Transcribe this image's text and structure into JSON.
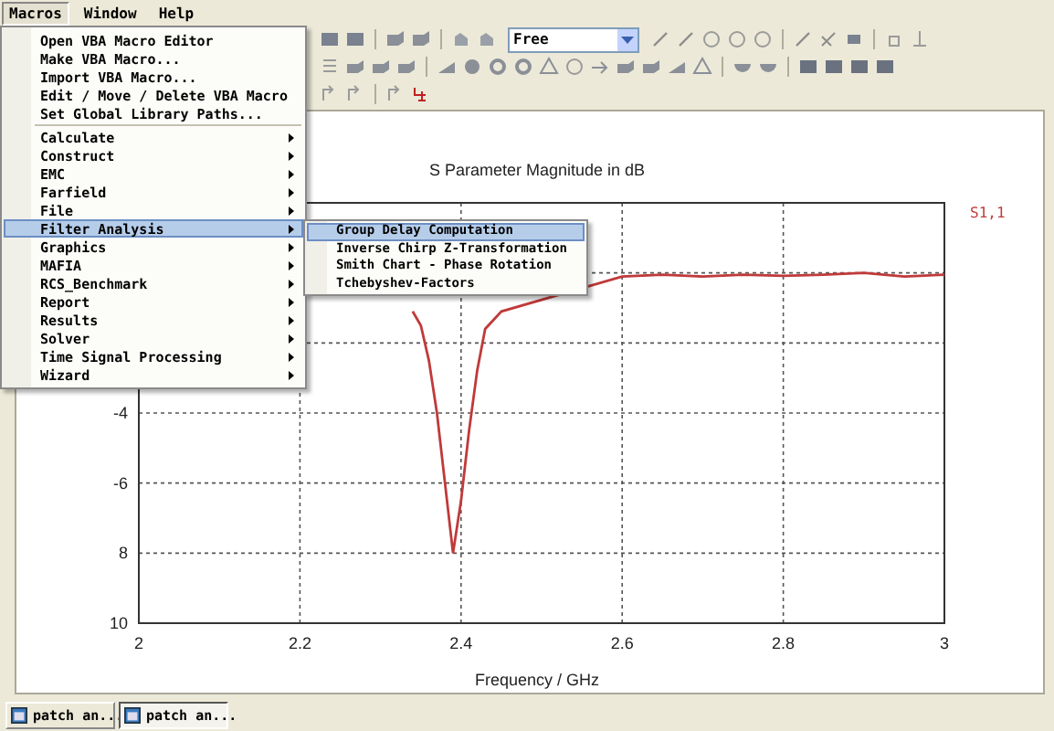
{
  "menubar": [
    {
      "label": "Macros",
      "selected": true
    },
    {
      "label": "Window",
      "selected": false
    },
    {
      "label": "Help",
      "selected": false
    }
  ],
  "toolbar": {
    "dropdown": "Free"
  },
  "macros_menu": [
    {
      "kind": "item",
      "label": "Open VBA Macro Editor",
      "selected": false
    },
    {
      "kind": "item",
      "label": "Make VBA Macro...",
      "selected": false
    },
    {
      "kind": "item",
      "label": "Import VBA Macro...",
      "selected": false
    },
    {
      "kind": "item",
      "label": "Edit / Move / Delete VBA Macro",
      "selected": false
    },
    {
      "kind": "item",
      "label": "Set Global Library Paths...",
      "selected": false
    },
    {
      "kind": "separator"
    },
    {
      "kind": "submenu",
      "label": "Calculate",
      "selected": false
    },
    {
      "kind": "submenu",
      "label": "Construct",
      "selected": false
    },
    {
      "kind": "submenu",
      "label": "EMC",
      "selected": false
    },
    {
      "kind": "submenu",
      "label": "Farfield",
      "selected": false
    },
    {
      "kind": "submenu",
      "label": "File",
      "selected": false
    },
    {
      "kind": "submenu",
      "label": "Filter Analysis",
      "selected": true
    },
    {
      "kind": "submenu",
      "label": "Graphics",
      "selected": false
    },
    {
      "kind": "submenu",
      "label": "MAFIA",
      "selected": false
    },
    {
      "kind": "submenu",
      "label": "RCS_Benchmark",
      "selected": false
    },
    {
      "kind": "submenu",
      "label": "Report",
      "selected": false
    },
    {
      "kind": "submenu",
      "label": "Results",
      "selected": false
    },
    {
      "kind": "submenu",
      "label": "Solver",
      "selected": false
    },
    {
      "kind": "submenu",
      "label": "Time Signal Processing",
      "selected": false
    },
    {
      "kind": "submenu",
      "label": "Wizard",
      "selected": false
    }
  ],
  "filter_submenu": [
    {
      "label": "Group Delay Computation",
      "selected": true
    },
    {
      "label": "Inverse Chirp Z-Transformation",
      "selected": false
    },
    {
      "label": "Smith Chart - Phase Rotation",
      "selected": false
    },
    {
      "label": "Tchebyshev-Factors",
      "selected": false
    }
  ],
  "chart": {
    "chart_data": {
      "type": "line",
      "grid": true,
      "title": "S Parameter Magnitude in dB",
      "xlabel": "Frequency / GHz",
      "xlim": [
        2,
        3
      ],
      "ylim": [
        -10,
        2
      ],
      "xticks": [
        2,
        2.2,
        2.4,
        2.6,
        2.8,
        3
      ],
      "yticks": [
        {
          "value": -4,
          "label": "-4"
        },
        {
          "value": -6,
          "label": "-6"
        },
        {
          "value": -8,
          "label": "8"
        },
        {
          "value": -10,
          "label": "10"
        }
      ],
      "x": [
        2.34,
        2.35,
        2.36,
        2.37,
        2.38,
        2.39,
        2.4,
        2.41,
        2.42,
        2.43,
        2.45,
        2.6,
        2.65,
        2.7,
        2.75,
        2.8,
        2.85,
        2.9,
        2.95,
        3.0
      ],
      "series": [
        {
          "name": "S1,1",
          "color": "#c03a3a",
          "values": [
            -1.1,
            -1.5,
            -2.5,
            -4.0,
            -6.0,
            -8.0,
            -6.5,
            -4.5,
            -2.8,
            -1.6,
            -1.1,
            -0.1,
            -0.05,
            -0.1,
            -0.05,
            -0.08,
            -0.05,
            0.0,
            -0.1,
            -0.05
          ]
        }
      ]
    }
  },
  "taskbar": [
    {
      "label": "patch an...",
      "selected": false
    },
    {
      "label": "patch an...",
      "selected": true
    }
  ]
}
